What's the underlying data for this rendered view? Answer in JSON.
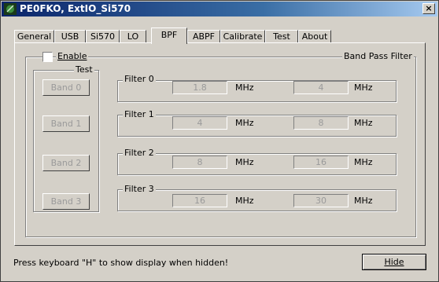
{
  "window": {
    "title": "PE0FKO, ExtIO_Si570",
    "close_glyph": "×"
  },
  "tabs": [
    {
      "label": "General"
    },
    {
      "label": "USB"
    },
    {
      "label": "Si570"
    },
    {
      "label": "LO"
    },
    {
      "label": "BPF",
      "active": true
    },
    {
      "label": "ABPF"
    },
    {
      "label": "Calibrate"
    },
    {
      "label": "Test"
    },
    {
      "label": "About"
    }
  ],
  "bpf": {
    "enable_label": "Enable",
    "enable_checked": false,
    "group_title": "Band Pass Filter",
    "test": {
      "title": "Test",
      "buttons": [
        "Band 0",
        "Band 1",
        "Band 2",
        "Band 3"
      ]
    },
    "filters": [
      {
        "title": "Filter 0",
        "low": "1.8",
        "high": "4",
        "unit": "MHz"
      },
      {
        "title": "Filter 1",
        "low": "4",
        "high": "8",
        "unit": "MHz"
      },
      {
        "title": "Filter 2",
        "low": "8",
        "high": "16",
        "unit": "MHz"
      },
      {
        "title": "Filter 3",
        "low": "16",
        "high": "30",
        "unit": "MHz"
      }
    ]
  },
  "footer": {
    "status": "Press keyboard \"H\" to show display when hidden!",
    "hide_label": "Hide"
  },
  "colors": {
    "titlebar_start": "#0a246a",
    "titlebar_end": "#a6caf0",
    "face": "#d4d0c8",
    "disabled_text": "#9a9a9a"
  }
}
